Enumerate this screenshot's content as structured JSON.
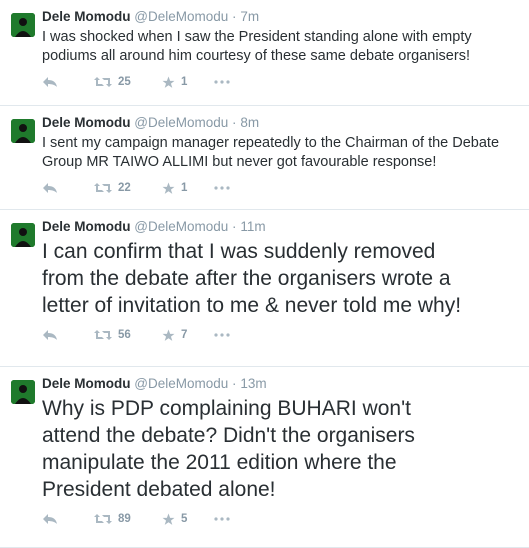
{
  "tweets": [
    {
      "name": "Dele Momodu",
      "handle": "@DeleMomodu",
      "separator": "·",
      "time": "7m",
      "text": "I was shocked when I saw the President standing alone with empty\npodiums all around him courtesy of these same debate organisers!",
      "retweets": "25",
      "favorites": "1"
    },
    {
      "name": "Dele Momodu",
      "handle": "@DeleMomodu",
      "separator": "·",
      "time": "8m",
      "text": "I sent my campaign manager repeatedly to the Chairman of the Debate\nGroup MR TAIWO ALLIMI but never got favourable response!",
      "retweets": "22",
      "favorites": "1"
    },
    {
      "name": "Dele Momodu",
      "handle": "@DeleMomodu",
      "separator": "·",
      "time": "11m",
      "text": "I can confirm that I was suddenly removed\nfrom the debate after the organisers wrote a\nletter of invitation to me & never told me why!",
      "retweets": "56",
      "favorites": "7"
    },
    {
      "name": "Dele Momodu",
      "handle": "@DeleMomodu",
      "separator": "·",
      "time": "13m",
      "text": "Why is PDP complaining BUHARI won't\nattend the debate? Didn't the organisers\nmanipulate the 2011 edition where the\nPresident debated alone!",
      "retweets": "89",
      "favorites": "5"
    }
  ],
  "icons": {
    "avatar": "profile-avatar",
    "reply": "reply-icon",
    "retweet": "retweet-icon",
    "favorite": "star-icon",
    "more": "more-dots-icon"
  },
  "colors": {
    "avatar_bg": "#1f7a2c",
    "icon": "#aab8c2",
    "meta": "#8899a6",
    "divider": "#e1e8ed"
  }
}
